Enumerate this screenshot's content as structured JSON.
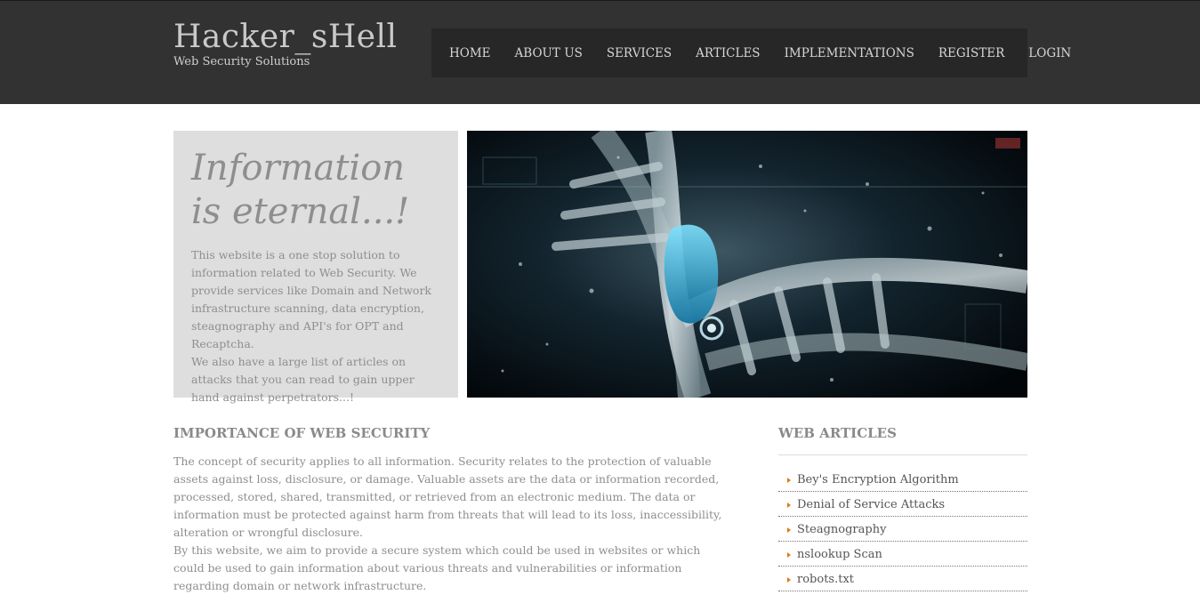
{
  "header": {
    "title": "Hacker_sHell",
    "tagline": "Web Security Solutions"
  },
  "nav": {
    "items": [
      "HOME",
      "ABOUT US",
      "SERVICES",
      "ARTICLES",
      "IMPLEMENTATIONS",
      "REGISTER",
      "LOGIN"
    ]
  },
  "intro": {
    "heading": "Information is eternal...!",
    "paragraph1": "This website is a one stop solution to information related to Web Security. We provide services like Domain and Network infrastructure scanning, data encryption, steagnography and API's for OPT and Recaptcha.",
    "paragraph2": "We also have a large list of articles on attacks that you can read to gain upper hand against perpetrators...!"
  },
  "hero": {
    "image": "dna-helix-digital-illustration"
  },
  "main": {
    "heading": "IMPORTANCE OF WEB SECURITY",
    "paragraph1": "The concept of security applies to all information. Security relates to the protection of valuable assets against loss, disclosure, or damage. Valuable assets are the data or information recorded, processed, stored, shared, transmitted, or retrieved from an electronic medium. The data or information must be protected against harm from threats that will lead to its loss, inaccessibility, alteration or wrongful disclosure.",
    "paragraph2": "By this website, we aim to provide a secure system which could be used in websites or which could be used to gain information about various threats and vulnerabilities or information regarding domain or network infrastructure."
  },
  "articles": {
    "heading": "WEB ARTICLES",
    "items": [
      "Bey's Encryption Algorithm",
      "Denial of Service Attacks",
      "Steagnography",
      "nslookup Scan",
      "robots.txt"
    ]
  },
  "colors": {
    "header_bg": "#323232",
    "nav_bg": "#272727",
    "intro_bg": "#dedede",
    "bullet": "#e07a10"
  }
}
